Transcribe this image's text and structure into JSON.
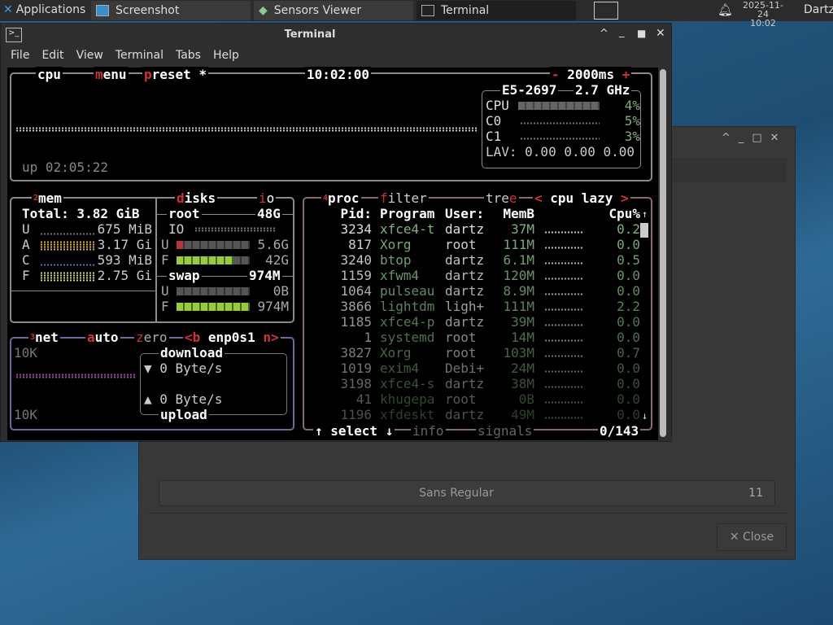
{
  "taskbar": {
    "applications": "Applications",
    "tabs": [
      "Screenshot",
      "Sensors Viewer",
      "Terminal"
    ],
    "date": "2025-11-24",
    "time": "10:02",
    "user": "Dartz"
  },
  "window": {
    "title": "Terminal",
    "menu": [
      "File",
      "Edit",
      "View",
      "Terminal",
      "Tabs",
      "Help"
    ]
  },
  "bg_window": {
    "font_value": "Sans Regular",
    "font_size": "11",
    "close": "✕ Close"
  },
  "cpu": {
    "title": "cpu",
    "menu": "menu",
    "preset": "preset *",
    "clock": "10:02:00",
    "interval": "- 2000ms +",
    "uptime": "up 02:05:22",
    "model": "E5-2697",
    "freq": "2.7 GHz",
    "rows": [
      {
        "label": "CPU",
        "value": "4%"
      },
      {
        "label": "C0",
        "value": "5%"
      },
      {
        "label": "C1",
        "value": "3%"
      }
    ],
    "lav": "LAV: 0.00 0.00 0.00"
  },
  "mem": {
    "title": "mem",
    "num": "2",
    "total": "Total: 3.82 GiB",
    "rows": [
      {
        "label": "U",
        "value": "675 MiB"
      },
      {
        "label": "A",
        "value": "3.17 Gi"
      },
      {
        "label": "C",
        "value": "593 MiB"
      },
      {
        "label": "F",
        "value": "2.75 Gi"
      }
    ]
  },
  "disks": {
    "title": "disks",
    "io": "io",
    "root": "root",
    "root_size": "48G",
    "io_label": "IO",
    "root_used": "5.6G",
    "root_used_pct": 12,
    "root_free": "42G",
    "root_free_pct": 78,
    "swap": "swap",
    "swap_size": "974M",
    "swap_used": "0B",
    "swap_used_pct": 0,
    "swap_free": "974M",
    "swap_free_pct": 100
  },
  "net": {
    "title": "net",
    "num": "3",
    "auto": "auto",
    "zero": "zero",
    "iface": "<b enp0s1 n>",
    "scale_top": "10K",
    "scale_bottom": "10K",
    "download": "download",
    "down_rate": "▼ 0 Byte/s",
    "up_rate": "▲ 0 Byte/s",
    "upload": "upload"
  },
  "proc": {
    "title": "proc",
    "num": "4",
    "filter": "filter",
    "tree": "tree",
    "sort": "< cpu lazy >",
    "headers": [
      "Pid:",
      "Program",
      "User:",
      "MemB",
      "Cpu%"
    ],
    "rows": [
      [
        "3234",
        "xfce4-t",
        "dartz",
        "37M",
        "0.2"
      ],
      [
        "817",
        "Xorg",
        "root",
        "111M",
        "0.0"
      ],
      [
        "3240",
        "btop",
        "dartz",
        "6.1M",
        "0.5"
      ],
      [
        "1159",
        "xfwm4",
        "dartz",
        "120M",
        "0.0"
      ],
      [
        "1064",
        "pulseau",
        "dartz",
        "8.9M",
        "0.0"
      ],
      [
        "3866",
        "lightdm",
        "ligh+",
        "111M",
        "2.2"
      ],
      [
        "1185",
        "xfce4-p",
        "dartz",
        "39M",
        "0.0"
      ],
      [
        "1",
        "systemd",
        "root",
        "14M",
        "0.0"
      ],
      [
        "3827",
        "Xorg",
        "root",
        "103M",
        "0.7"
      ],
      [
        "1019",
        "exim4",
        "Debi+",
        "24M",
        "0.0"
      ],
      [
        "3198",
        "xfce4-s",
        "dartz",
        "38M",
        "0.0"
      ],
      [
        "41",
        "khugepa",
        "root",
        "0B",
        "0.0"
      ],
      [
        "1196",
        "xfdeskt",
        "dartz",
        "49M",
        "0.0"
      ]
    ],
    "select": "↑ select ↓",
    "info": "info",
    "signals": "signals",
    "count": "0/143"
  }
}
